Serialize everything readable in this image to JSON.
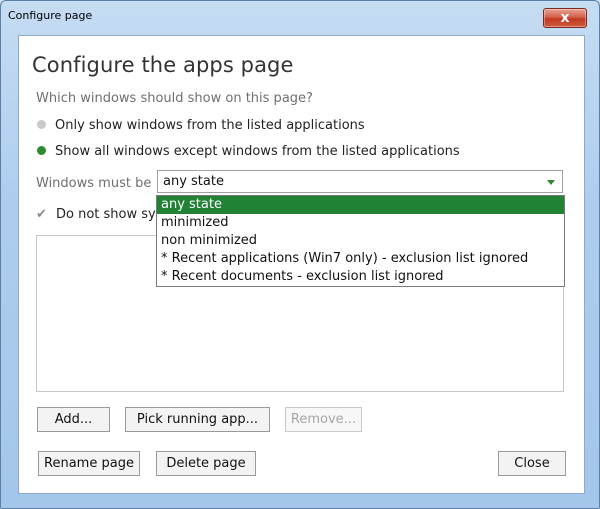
{
  "window": {
    "title": "Configure page",
    "close_glyph": "x"
  },
  "dialog": {
    "heading": "Configure the apps page",
    "question": "Which windows should show on this page?",
    "radio_options": [
      {
        "label": "Only show windows from the listed applications",
        "selected": false
      },
      {
        "label": "Show all windows except windows from the listed applications",
        "selected": true
      }
    ],
    "state_label": "Windows must be",
    "state_value": "any state",
    "checkbox_label": "Do not show syste",
    "checkbox_checked": true
  },
  "dropdown": {
    "options": [
      "any state",
      "minimized",
      "non minimized",
      "* Recent applications (Win7 only) - exclusion list ignored",
      "* Recent documents - exclusion list ignored"
    ],
    "selected_index": 0
  },
  "buttons": {
    "add": "Add...",
    "pick": "Pick running app...",
    "remove": "Remove...",
    "rename": "Rename page",
    "delete": "Delete page",
    "close": "Close"
  },
  "colors": {
    "accent_green": "#2f8a2f",
    "selection_green": "#218236",
    "close_red": "#c2391f"
  },
  "icons": {
    "close": "close-icon",
    "dropdown": "chevron-down-icon",
    "check": "check-icon"
  }
}
